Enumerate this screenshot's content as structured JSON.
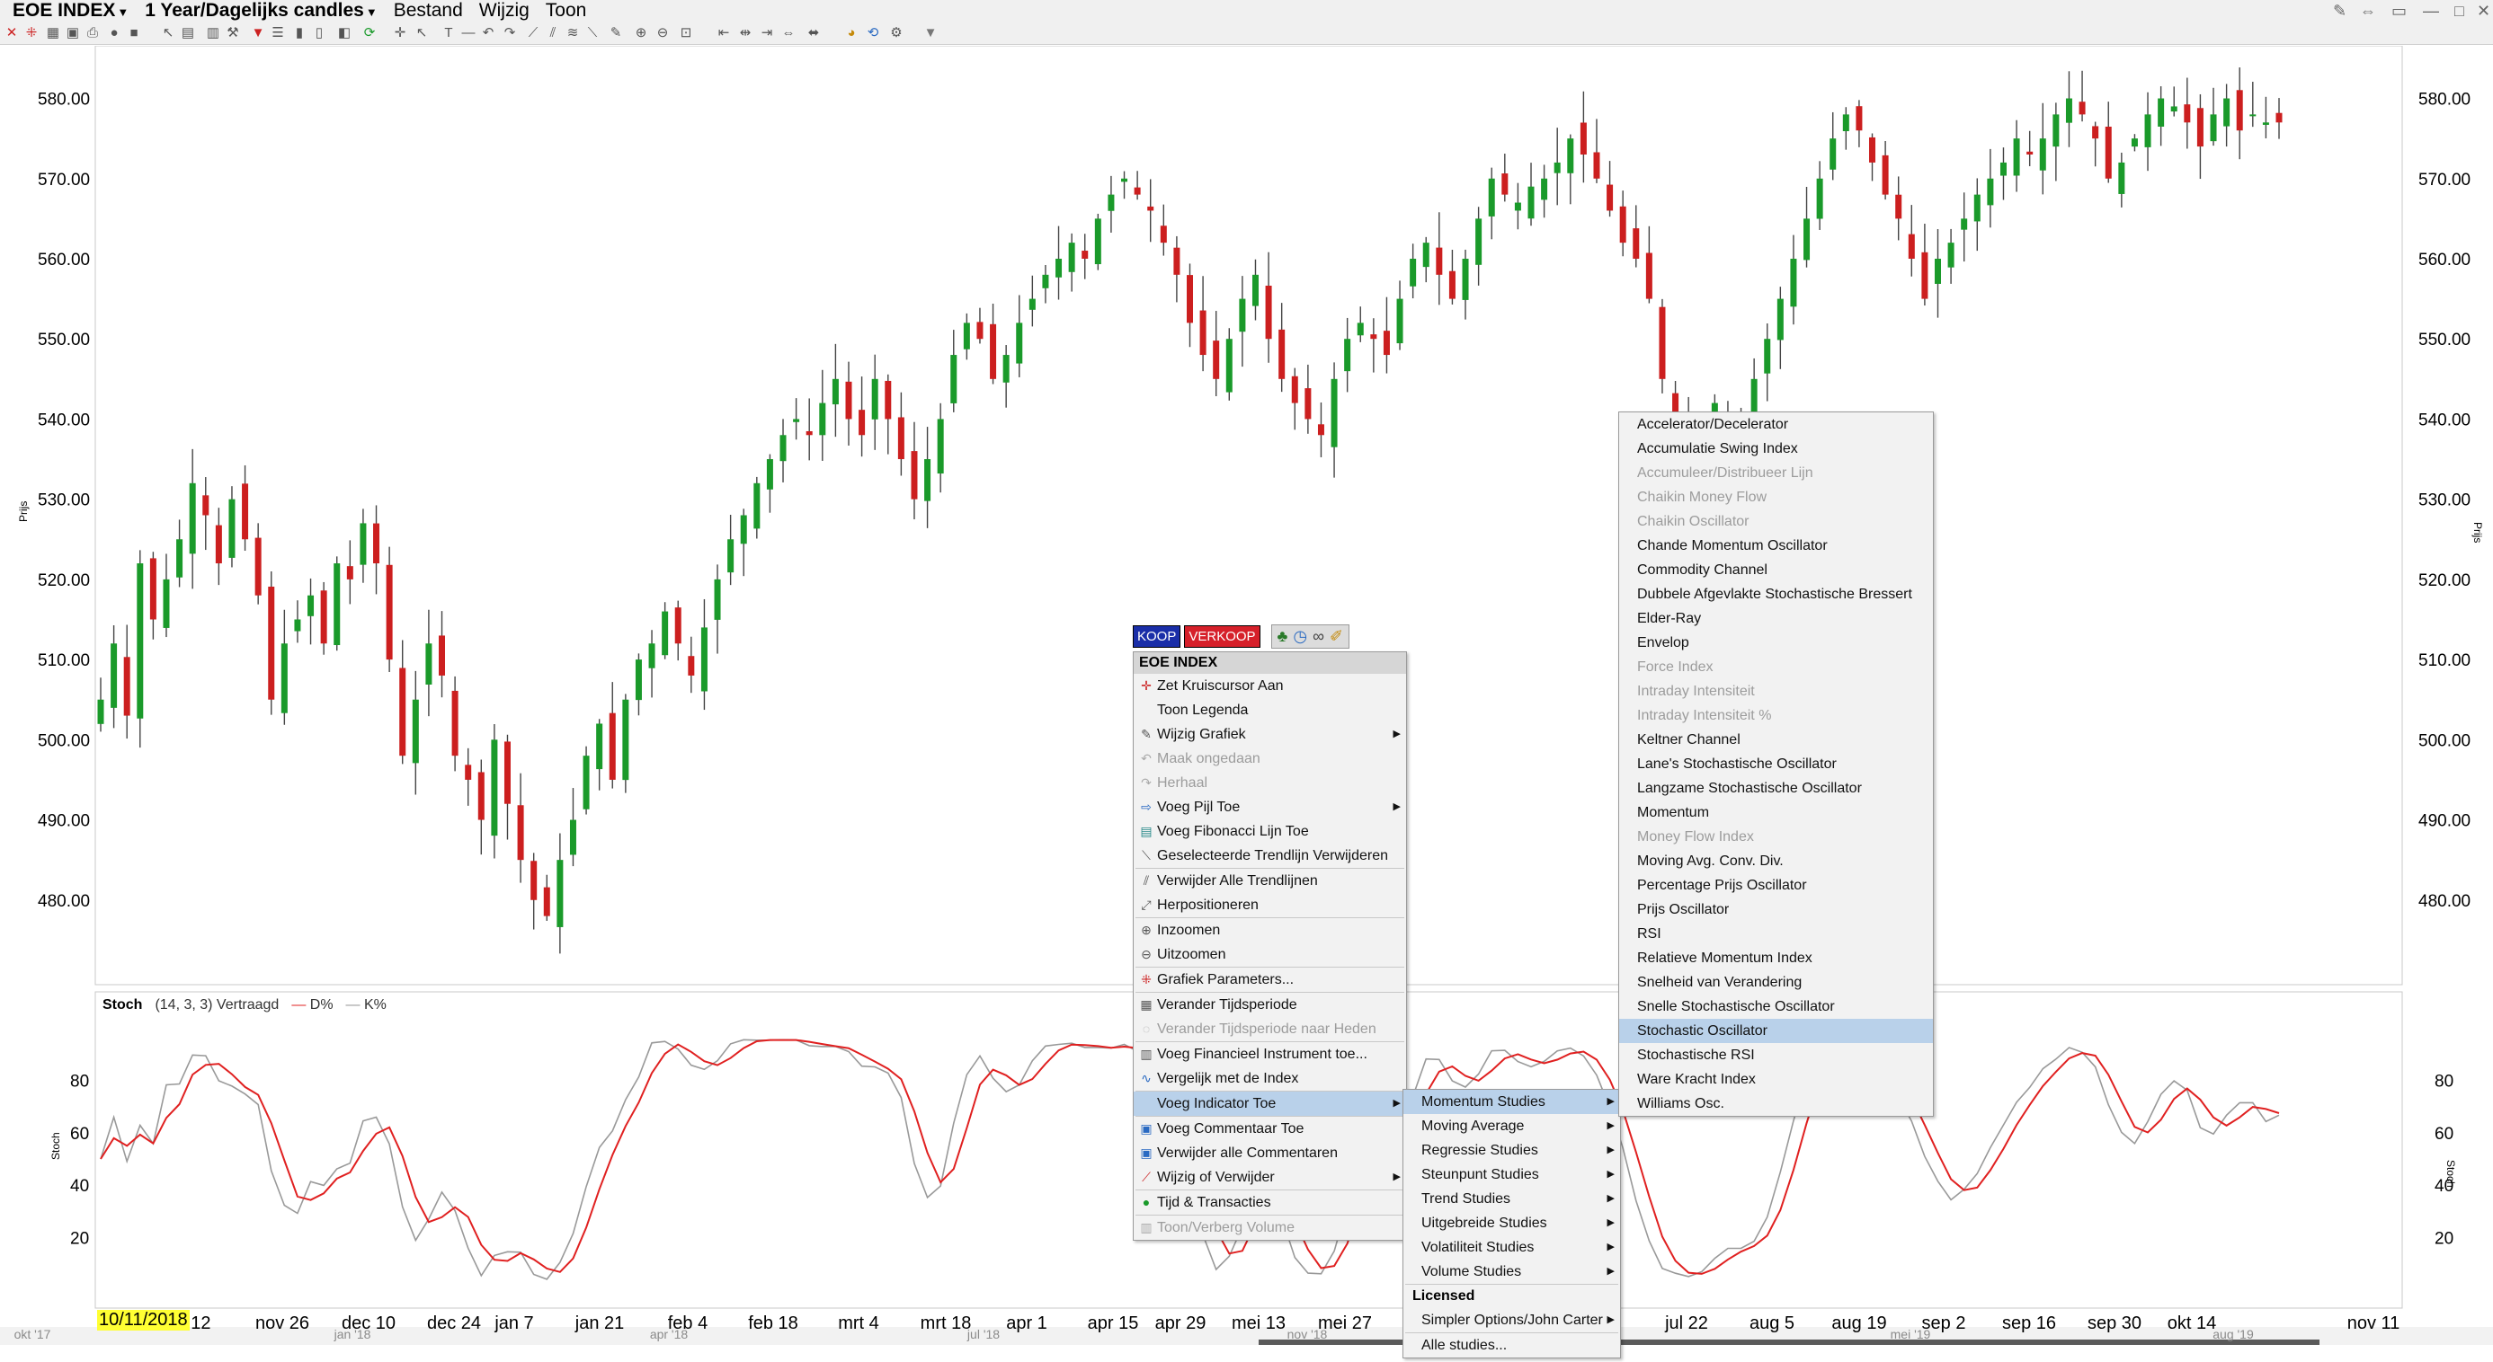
{
  "menubar": {
    "instrument": "EOE INDEX",
    "period": "1 Year/Dagelijks candles",
    "menus": [
      "Bestand",
      "Wijzig",
      "Toon"
    ]
  },
  "price_axis": {
    "title": "Prijs",
    "ticks": [
      "580.00",
      "570.00",
      "560.00",
      "550.00",
      "540.00",
      "530.00",
      "520.00",
      "510.00",
      "500.00",
      "490.00",
      "480.00"
    ]
  },
  "stoch": {
    "name": "Stoch",
    "params": "(14, 3, 3) Vertraagd",
    "d_label": "D%",
    "k_label": "K%",
    "axis_title": "Stoch",
    "ticks": [
      "80",
      "60",
      "40",
      "20"
    ]
  },
  "date_axis": {
    "start_date": "10/11/2018",
    "labels": [
      "ov 12",
      "nov 26",
      "dec 10",
      "dec 24",
      "jan 7",
      "jan 21",
      "feb 4",
      "feb 18",
      "mrt 4",
      "mrt 18",
      "apr 1",
      "apr 15",
      "apr 29",
      "mei 13",
      "mei 27",
      "jul 22",
      "aug 5",
      "aug 19",
      "sep 2",
      "sep 16",
      "sep 30",
      "okt 14",
      "nov 11"
    ]
  },
  "overview_axis": {
    "labels": [
      "okt '17",
      "jan '18",
      "apr '18",
      "jul '18",
      "nov '18",
      "mei '19",
      "aug '19"
    ]
  },
  "context_menu": {
    "buy": "KOOP",
    "sell": "VERKOOP",
    "header": "EOE INDEX",
    "items": [
      {
        "label": "Zet Kruiscursor Aan",
        "disabled": false
      },
      {
        "label": "Toon Legenda",
        "disabled": false
      },
      {
        "label": "Wijzig Grafiek",
        "disabled": false
      },
      {
        "label": "Maak ongedaan",
        "disabled": true
      },
      {
        "label": "Herhaal",
        "disabled": true
      },
      {
        "label": "Voeg Pijl Toe",
        "disabled": false
      },
      {
        "label": "Voeg Fibonacci Lijn Toe",
        "disabled": false
      },
      {
        "label": "Geselecteerde Trendlijn Verwijderen",
        "disabled": false
      },
      {
        "label": "Verwijder Alle Trendlijnen",
        "disabled": false
      },
      {
        "label": "Herpositioneren",
        "disabled": false
      },
      {
        "label": "Inzoomen",
        "disabled": false
      },
      {
        "label": "Uitzoomen",
        "disabled": false
      },
      {
        "label": "Grafiek Parameters...",
        "disabled": false
      },
      {
        "label": "Verander Tijdsperiode",
        "disabled": false
      },
      {
        "label": "Verander Tijdsperiode naar Heden",
        "disabled": true
      },
      {
        "label": "Voeg Financieel Instrument toe...",
        "disabled": false
      },
      {
        "label": "Vergelijk met de Index",
        "disabled": false
      },
      {
        "label": "Voeg Indicator Toe",
        "disabled": false
      },
      {
        "label": "Voeg Commentaar Toe",
        "disabled": false
      },
      {
        "label": "Verwijder alle Commentaren",
        "disabled": false
      },
      {
        "label": "Wijzig of Verwijder",
        "disabled": false
      },
      {
        "label": "Tijd & Transacties",
        "disabled": false
      },
      {
        "label": "Toon/Verberg Volume",
        "disabled": true
      }
    ]
  },
  "studies_menu": {
    "items": [
      "Momentum Studies",
      "Moving Average",
      "Regressie Studies",
      "Steunpunt Studies",
      "Trend Studies",
      "Uitgebreide Studies",
      "Volatiliteit Studies",
      "Volume Studies"
    ],
    "licensed_header": "Licensed",
    "licensed_items": [
      "Simpler Options/John Carter"
    ],
    "all_studies": "Alle studies..."
  },
  "momentum_menu": {
    "items": [
      {
        "label": "Accelerator/Decelerator",
        "disabled": false
      },
      {
        "label": "Accumulatie Swing Index",
        "disabled": false
      },
      {
        "label": "Accumuleer/Distribueer Lijn",
        "disabled": true
      },
      {
        "label": "Chaikin Money Flow",
        "disabled": true
      },
      {
        "label": "Chaikin Oscillator",
        "disabled": true
      },
      {
        "label": "Chande Momentum Oscillator",
        "disabled": false
      },
      {
        "label": "Commodity Channel",
        "disabled": false
      },
      {
        "label": "Dubbele Afgevlakte Stochastische Bressert",
        "disabled": false
      },
      {
        "label": "Elder-Ray",
        "disabled": false
      },
      {
        "label": "Envelop",
        "disabled": false
      },
      {
        "label": "Force Index",
        "disabled": true
      },
      {
        "label": "Intraday Intensiteit",
        "disabled": true
      },
      {
        "label": "Intraday Intensiteit %",
        "disabled": true
      },
      {
        "label": "Keltner Channel",
        "disabled": false
      },
      {
        "label": "Lane's Stochastische Oscillator",
        "disabled": false
      },
      {
        "label": "Langzame Stochastische Oscillator",
        "disabled": false
      },
      {
        "label": "Momentum",
        "disabled": false
      },
      {
        "label": "Money Flow Index",
        "disabled": true
      },
      {
        "label": "Moving Avg. Conv. Div.",
        "disabled": false
      },
      {
        "label": "Percentage Prijs Oscillator",
        "disabled": false
      },
      {
        "label": "Prijs Oscillator",
        "disabled": false
      },
      {
        "label": "RSI",
        "disabled": false
      },
      {
        "label": "Relatieve Momentum Index",
        "disabled": false
      },
      {
        "label": "Snelheid van Verandering",
        "disabled": false
      },
      {
        "label": "Snelle Stochastische Oscillator",
        "disabled": false
      },
      {
        "label": "Stochastic Oscillator",
        "disabled": false
      },
      {
        "label": "Stochastische RSI",
        "disabled": false
      },
      {
        "label": "Ware Kracht Index",
        "disabled": false
      },
      {
        "label": "Williams Osc.",
        "disabled": false
      }
    ]
  },
  "colors": {
    "up": "#1a9a2a",
    "down": "#cc1f1f",
    "d_line": "#e02020",
    "k_line": "#999999",
    "highlight": "#b9d1ea"
  },
  "chart_data": {
    "type": "candlestick",
    "ylim": [
      470,
      586
    ],
    "closes": [
      505,
      512,
      503,
      522,
      515,
      520,
      525,
      532,
      528,
      522,
      530,
      525,
      518,
      505,
      512,
      515,
      518,
      512,
      522,
      520,
      527,
      522,
      510,
      498,
      505,
      512,
      508,
      498,
      495,
      490,
      500,
      492,
      485,
      480,
      478,
      485,
      490,
      498,
      502,
      495,
      505,
      510,
      512,
      516,
      512,
      508,
      514,
      520,
      525,
      528,
      532,
      535,
      538,
      540,
      538,
      542,
      545,
      540,
      538,
      545,
      540,
      535,
      530,
      535,
      540,
      548,
      552,
      550,
      545,
      548,
      552,
      555,
      558,
      560,
      562,
      560,
      565,
      568,
      570,
      568,
      566,
      562,
      558,
      552,
      548,
      545,
      550,
      555,
      558,
      550,
      545,
      542,
      540,
      538,
      545,
      550,
      552,
      550,
      548,
      555,
      560,
      562,
      558,
      555,
      560,
      565,
      570,
      568,
      567,
      569,
      570,
      572,
      575,
      573,
      570,
      566,
      562,
      560,
      555,
      545,
      540,
      535,
      538,
      542,
      540,
      538,
      545,
      550,
      555,
      560,
      565,
      570,
      575,
      578,
      576,
      572,
      568,
      565,
      560,
      555,
      560,
      562,
      565,
      568,
      570,
      572,
      575,
      573,
      575,
      578,
      580,
      578,
      575,
      570,
      572,
      575,
      578,
      580,
      579,
      577,
      574,
      578,
      580,
      576,
      578,
      577,
      577
    ]
  }
}
